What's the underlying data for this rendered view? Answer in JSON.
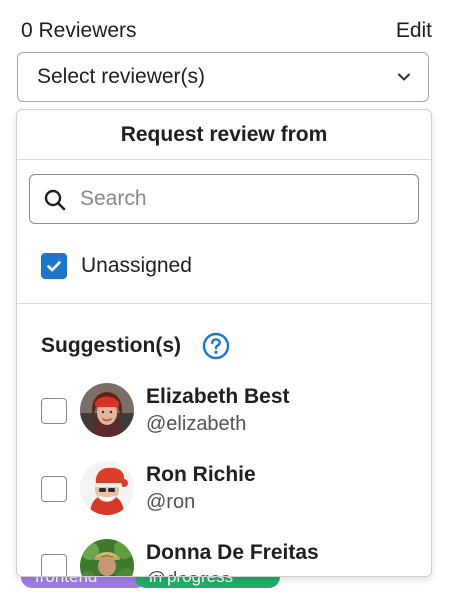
{
  "header": {
    "reviewers_title": "0 Reviewers",
    "edit_label": "Edit"
  },
  "select": {
    "placeholder": "Select reviewer(s)"
  },
  "dropdown": {
    "title": "Request review from",
    "search_placeholder": "Search",
    "unassigned_label": "Unassigned",
    "unassigned_checked": true,
    "suggestions_heading": "Suggestion(s)",
    "users": [
      {
        "name": "Elizabeth Best",
        "handle": "@elizabeth",
        "checked": false
      },
      {
        "name": "Ron Richie",
        "handle": "@ron",
        "checked": false
      },
      {
        "name": "Donna De Freitas",
        "handle": "@dosgos",
        "checked": false
      }
    ]
  },
  "labels": [
    {
      "text": "frontend",
      "color": "#9e7fe5"
    },
    {
      "text": "in progress",
      "color": "#24ad6a"
    }
  ],
  "colors": {
    "accent": "#1f75cb",
    "text": "#1f1e24",
    "muted": "#535158"
  }
}
